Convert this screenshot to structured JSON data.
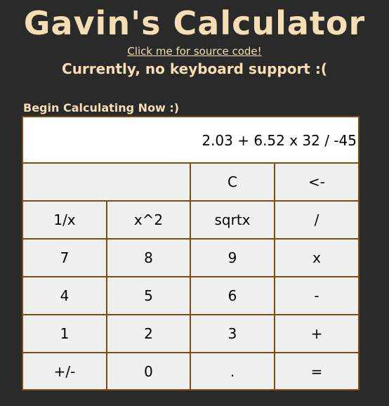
{
  "header": {
    "title": "Gavin's Calculator",
    "source_link": "Click me for source code!",
    "keyboard_note": "Currently, no keyboard support :("
  },
  "prompt": "Begin Calculating Now :)",
  "display": {
    "expression": "2.03 + 6.52 x 32 / -45"
  },
  "keys": {
    "clear": "C",
    "backspace": "<-",
    "reciprocal": "1/x",
    "square": "x^2",
    "sqrt": "sqrtx",
    "divide": "/",
    "seven": "7",
    "eight": "8",
    "nine": "9",
    "multiply": "x",
    "four": "4",
    "five": "5",
    "six": "6",
    "subtract": "-",
    "one": "1",
    "two": "2",
    "three": "3",
    "add": "+",
    "negate": "+/-",
    "zero": "0",
    "decimal": ".",
    "equals": "="
  },
  "colors": {
    "background": "#2a2a2a",
    "text": "#f5deb3",
    "grid_border": "#7a4e12",
    "key_face": "#f1f0f0",
    "display_face": "#ffffff"
  }
}
